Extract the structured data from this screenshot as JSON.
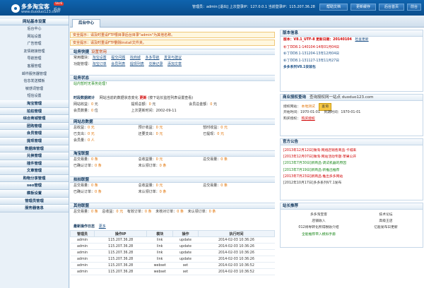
{
  "header": {
    "logo_title": "多多淘宝客",
    "logo_badge": "Ver6",
    "logo_suffix": "后台",
    "logo_url": "www.duoduo123.com",
    "admin_label": "管理员：",
    "admin_name": "admin",
    "exit_label": "[退出]",
    "last_ip_label": "上次登录IP：",
    "last_ip": "127.0.0.1",
    "cur_ip_label": "当前登录IP：",
    "cur_ip": "115.207.36.28",
    "buttons": [
      "帮助文档",
      "更新缓存",
      "后台首页",
      "前台"
    ]
  },
  "sidebar": {
    "section_title": "网站基本设置",
    "items": [
      "后台中心",
      "网站设置",
      "广告管理",
      "友情链接管理",
      "导航管理",
      "客服管理",
      "邮件服务器管理",
      "信息发送模板",
      "敏感词管理",
      "短信设置"
    ],
    "groups": [
      "淘宝管理",
      "拍拍管理",
      "综合商城管理",
      "团购管理",
      "会员管理",
      "提现管理",
      "数据库管理",
      "兑换管理",
      "插件管理",
      "文章管理",
      "购物分享管理",
      "seo管理",
      "模板设置",
      "管理员管理",
      "服务器信息"
    ]
  },
  "tab_label": "后台中心",
  "notices": [
    "安全提示：请及时重设FTP根目录后台目录\"admin\"为其他名称。",
    "安全提示：请及时重设FTP删除install文件夹。"
  ],
  "shortcuts": {
    "title": "站务快捷",
    "more": "设置常用",
    "row1_label": "常用模块：",
    "row1": [
      "淘宝设置",
      "提交问题",
      "找商城",
      "多多导航",
      "发货与建议"
    ],
    "row2_label": "功能管理：",
    "row2": [
      "淘宝订单",
      "会员列表",
      "提现列表",
      "兑换记录",
      "添加文章"
    ]
  },
  "status": {
    "title": "站务状态",
    "text": "站内暂时无事务处理！"
  },
  "timeinfo": {
    "title_label": "时段数据统计",
    "title_desc": "网站当前的数据状态变化",
    "title_link": "更新",
    "title_note": "(按下站长监控列表设置查看)",
    "r1": [
      [
        "网站收益：",
        "0",
        "元"
      ],
      [
        "提现总额：",
        "0",
        "元"
      ],
      [
        "会员总金额：",
        "0",
        "元"
      ]
    ],
    "r2": [
      [
        "会员数量：",
        "0",
        "位"
      ],
      [
        "上次更新时间：",
        "2002-09-11"
      ]
    ]
  },
  "site": {
    "title": "网站总数据",
    "rows": [
      [
        [
          "总收益：",
          "0",
          "元"
        ],
        [
          "预计收益：",
          "0",
          "元"
        ],
        [
          "暂时收益：",
          "0",
          "元"
        ]
      ],
      [
        [
          "已支出：",
          "0",
          "元"
        ],
        [
          "还要支出：",
          "0",
          "元"
        ],
        [
          "已提现：",
          "0",
          "元"
        ]
      ],
      [
        [
          "会员量：",
          "0",
          "人"
        ]
      ]
    ]
  },
  "taobao": {
    "title": "淘宝联盟",
    "rows": [
      [
        [
          "总交易量：",
          "0",
          "条"
        ],
        [
          "总收益量：",
          "0",
          "元"
        ],
        [
          "总交易量：",
          "0",
          "条"
        ]
      ],
      [
        [
          "已确认订单：",
          "0",
          "条"
        ],
        [
          "未认领订单：",
          "0",
          "条"
        ]
      ]
    ]
  },
  "paipai": {
    "title": "拍拍联盟",
    "rows": [
      [
        [
          "总交易量：",
          "0",
          "条"
        ],
        [
          "总收益量：",
          "0",
          "元"
        ],
        [
          "总交易量：",
          "0",
          "条"
        ]
      ],
      [
        [
          "已确认订单：",
          "0",
          "条"
        ],
        [
          "未认领订单：",
          "0",
          "条"
        ]
      ]
    ]
  },
  "other": {
    "title": "其他联盟",
    "row": [
      [
        "总交易量：",
        "0",
        "条"
      ],
      [
        "总收益：",
        "0",
        "元"
      ],
      [
        "有效订单：",
        "0",
        "条"
      ],
      [
        "未核对订单：",
        "0",
        "条"
      ],
      [
        "未认领订单：",
        "0",
        "条"
      ]
    ]
  },
  "log": {
    "title": "最新操作日志",
    "more": "更多",
    "headers": [
      "管理员",
      "操作IP",
      "模块",
      "操作",
      "执行时间"
    ],
    "rows": [
      [
        "admin",
        "115.207.36.28",
        "link",
        "update",
        "2014-02-03 10:36:26"
      ],
      [
        "admin",
        "115.207.36.28",
        "link",
        "update",
        "2014-02-03 10:36:26"
      ],
      [
        "admin",
        "115.207.36.28",
        "link",
        "update",
        "2014-02-03 10:36:26"
      ],
      [
        "admin",
        "115.207.36.28",
        "link",
        "update",
        "2014-02-03 10:36:26"
      ],
      [
        "admin",
        "115.207.36.28",
        "webset",
        "set",
        "2014-02-03 10:36:52"
      ],
      [
        "admin",
        "115.207.36.28",
        "webset",
        "set",
        "2014-02-03 10:36:52"
      ]
    ]
  },
  "version": {
    "title": "版本信息",
    "ver_label": "版本：V8.1_UTF-8",
    "update_label": "更新日期：",
    "update_date": "20140104",
    "check": "检查更新",
    "lines": [
      "补丁DD8.1-140104-14年01月04日",
      "补丁DD8.1-131204-13年12月04日",
      "补丁DD8.1-131127-13年11月27日",
      "多多系列V8.1安装包"
    ]
  },
  "auth": {
    "title": "商业授权查询",
    "desc": "查询授权网一站点 duoduo123.com",
    "type_label": "授权网站：",
    "type_value": "本地测试",
    "query_btn": "查询",
    "start_label": "开始时间：",
    "start": "1970-01-01",
    "end_label": "到期时间：",
    "end": "1970-01-01",
    "buy_label": "购买授权：",
    "buy_link": "购买授权"
  },
  "notice_board": {
    "title": "官方公告",
    "items": [
      "[2013年12月12日]微淘·网络店销售商品·卡城来",
      "[2013年12月07日]微淘·网站活动专题·苹果公开",
      "[2013年7月30日]新商品·调试机器的原因",
      "[2013年7月19日]新商品·新推出推荐",
      "[2013年7月23日]新商品·推出多多网站",
      "[2012年10月17日]多多系列V7.1发布"
    ]
  },
  "recommend": {
    "title": "站长推荐",
    "items": [
      [
        "多多淘宝客",
        "技术论坛"
      ],
      [
        "店铺收入",
        "高级王店"
      ],
      [
        "012将导转化所得税收介绍",
        "亿能发布日更新"
      ],
      [
        "全能推荐带入模拟手册"
      ]
    ]
  }
}
